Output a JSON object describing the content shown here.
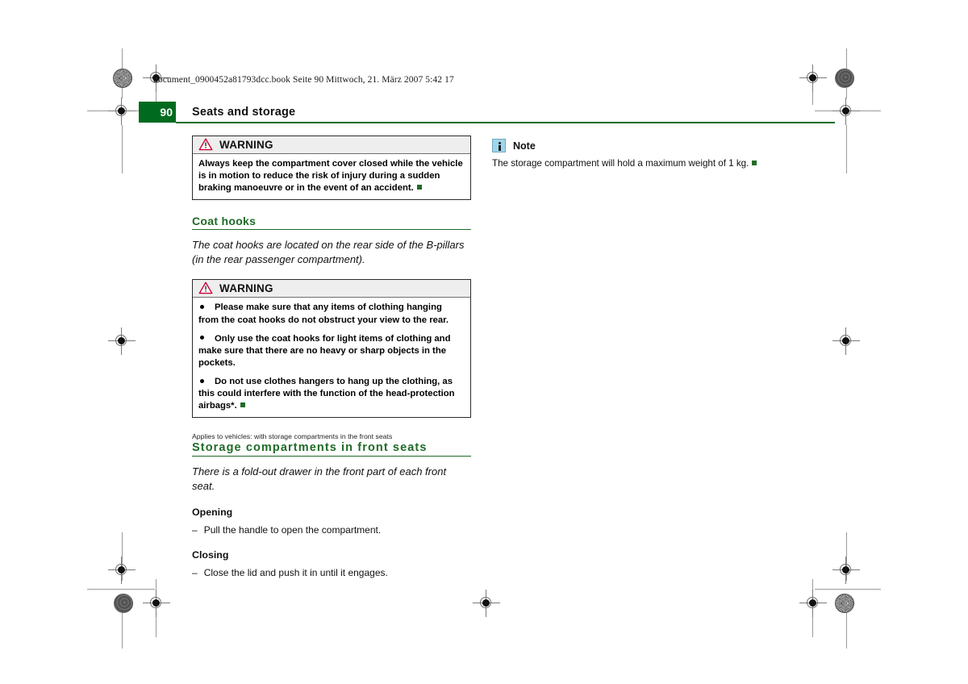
{
  "colors": {
    "green": "#1f6b27",
    "page_block_green": "#006b1f",
    "note_icon_blue": "#9fd6ea",
    "warning_red": "#cc0033"
  },
  "running_header": {
    "text": "document_0900452a81793dcc.book  Seite 90  Mittwoch, 21. März 2007  5:42 17"
  },
  "page_header": {
    "page_number": "90",
    "chapter_title": "Seats and storage"
  },
  "left_column": {
    "warning_1": {
      "label": "WARNING",
      "icon": "warning-triangle-icon",
      "paragraphs": [
        "Always keep the compartment cover closed while the vehicle is in motion to reduce the risk of injury during a sudden braking manoeuvre or in the event of an accident."
      ]
    },
    "coat_hooks": {
      "heading": "Coat hooks",
      "intro": "The coat hooks are located on the rear side of the B-pillars (in the rear passenger compartment).",
      "warning": {
        "label": "WARNING",
        "icon": "warning-triangle-icon",
        "bullets": [
          "Please make sure that any items of clothing hanging from the coat hooks do not obstruct your view to the rear.",
          "Only use the coat hooks for light items of clothing and make sure that there are no heavy or sharp objects in the pockets.",
          "Do not use clothes hangers to hang up the clothing, as this could interfere with the function of the head-protection airbags*."
        ]
      }
    },
    "storage_front_seats": {
      "applies_to": "Applies to vehicles: with storage compartments in the front seats",
      "heading": "Storage compartments in front seats",
      "intro": "There is a fold-out drawer in the front part of each front seat.",
      "opening": {
        "heading": "Opening",
        "dash": "–",
        "item": "Pull the handle to open the compartment."
      },
      "closing": {
        "heading": "Closing",
        "dash": "–",
        "item": "Close the lid and push it in until it engages."
      }
    }
  },
  "right_column": {
    "note": {
      "label": "Note",
      "icon": "info-icon",
      "body": "The storage compartment will hold a maximum weight of 1 kg."
    }
  }
}
